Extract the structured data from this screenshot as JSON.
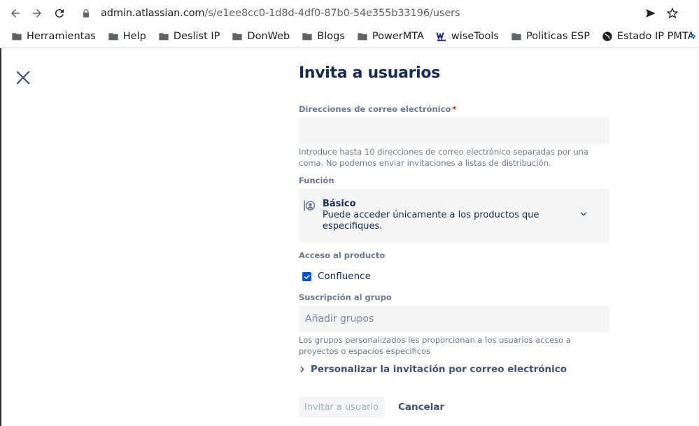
{
  "browser": {
    "url_host": "admin.atlassian.com",
    "url_path": "/s/e1ee8cc0-1d8d-4df0-87b0-54e355b33196/users",
    "bookmarks": [
      {
        "label": "Herramientas",
        "icon": "folder-icon"
      },
      {
        "label": "Help",
        "icon": "folder-icon"
      },
      {
        "label": "Deslist IP",
        "icon": "folder-icon"
      },
      {
        "label": "DonWeb",
        "icon": "folder-icon"
      },
      {
        "label": "Blogs",
        "icon": "folder-icon"
      },
      {
        "label": "PowerMTA",
        "icon": "folder-icon"
      },
      {
        "label": "wiseTools",
        "icon": "wisetools-icon"
      },
      {
        "label": "Politicas ESP",
        "icon": "folder-icon"
      },
      {
        "label": "Estado IP PMTA",
        "icon": "globe-icon"
      }
    ],
    "more_label": "»"
  },
  "dialog": {
    "title": "Invita a usuarios",
    "email": {
      "label": "Direcciones de correo electrónico",
      "required_mark": "*",
      "value": "",
      "placeholder": "",
      "help": "Introduce hasta 10 direcciones de correo electrónico separadas por una coma. No podemos enviar invitaciones a listas de distribución."
    },
    "role": {
      "label": "Función",
      "selected_title": "Básico",
      "selected_description": "Puede acceder únicamente a los productos que especifiques."
    },
    "product_access": {
      "label": "Acceso al producto",
      "items": [
        {
          "label": "Confluence",
          "checked": true
        }
      ]
    },
    "groups": {
      "label": "Suscripción al grupo",
      "placeholder": "Añadir grupos",
      "help": "Los grupos personalizados les proporcionan a los usuarios acceso a proyectos o espacios específicos"
    },
    "customize_label": "Personalizar la invitación por correo electrónico",
    "invite_button": "Invitar a usuario",
    "cancel_button": "Cancelar"
  },
  "colors": {
    "primary": "#0052cc",
    "text": "#172b4d",
    "subtle_text": "#6b778c",
    "field_bg": "#f4f5f7",
    "required": "#de350b"
  }
}
